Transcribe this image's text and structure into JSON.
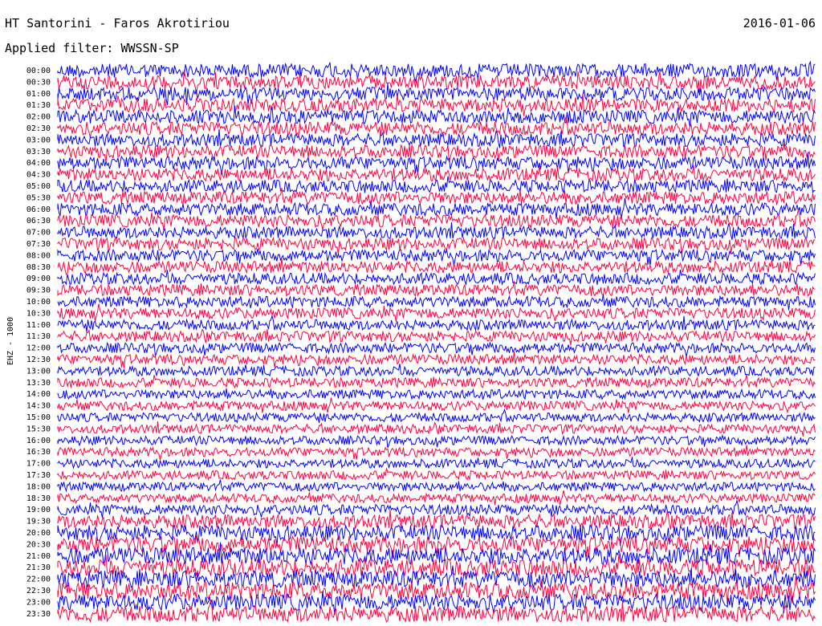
{
  "header": {
    "station": "HT Santorini - Faros Akrotiriou",
    "date": "2016-01-06",
    "filter": "Applied filter: WWSSN-SP"
  },
  "chart_data": {
    "type": "line",
    "ylabel": "EHZ - 1000",
    "row_labels": [
      "00:00",
      "00:30",
      "01:00",
      "01:30",
      "02:00",
      "02:30",
      "03:00",
      "03:30",
      "04:00",
      "04:30",
      "05:00",
      "05:30",
      "06:00",
      "06:30",
      "07:00",
      "07:30",
      "08:00",
      "08:30",
      "09:00",
      "09:30",
      "10:00",
      "10:30",
      "11:00",
      "11:30",
      "12:00",
      "12:30",
      "13:00",
      "13:30",
      "14:00",
      "14:30",
      "15:00",
      "15:30",
      "16:00",
      "16:30",
      "17:00",
      "17:30",
      "18:00",
      "18:30",
      "19:00",
      "19:30",
      "20:00",
      "20:30",
      "21:00",
      "21:30",
      "22:00",
      "22:30",
      "23:00",
      "23:30"
    ],
    "series_colors": [
      "#0000ff",
      "#ff0040"
    ],
    "relative_noise_level": [
      0.9,
      0.9,
      0.85,
      0.85,
      0.85,
      0.85,
      0.8,
      0.8,
      0.8,
      0.8,
      0.75,
      0.75,
      0.75,
      0.75,
      0.7,
      0.7,
      0.65,
      0.65,
      0.6,
      0.6,
      0.55,
      0.55,
      0.5,
      0.5,
      0.45,
      0.45,
      0.4,
      0.4,
      0.35,
      0.35,
      0.3,
      0.3,
      0.3,
      0.3,
      0.3,
      0.3,
      0.3,
      0.3,
      0.5,
      0.9,
      1.1,
      1.2,
      1.3,
      1.3,
      1.3,
      1.3,
      1.2,
      1.2
    ],
    "grid": false
  }
}
